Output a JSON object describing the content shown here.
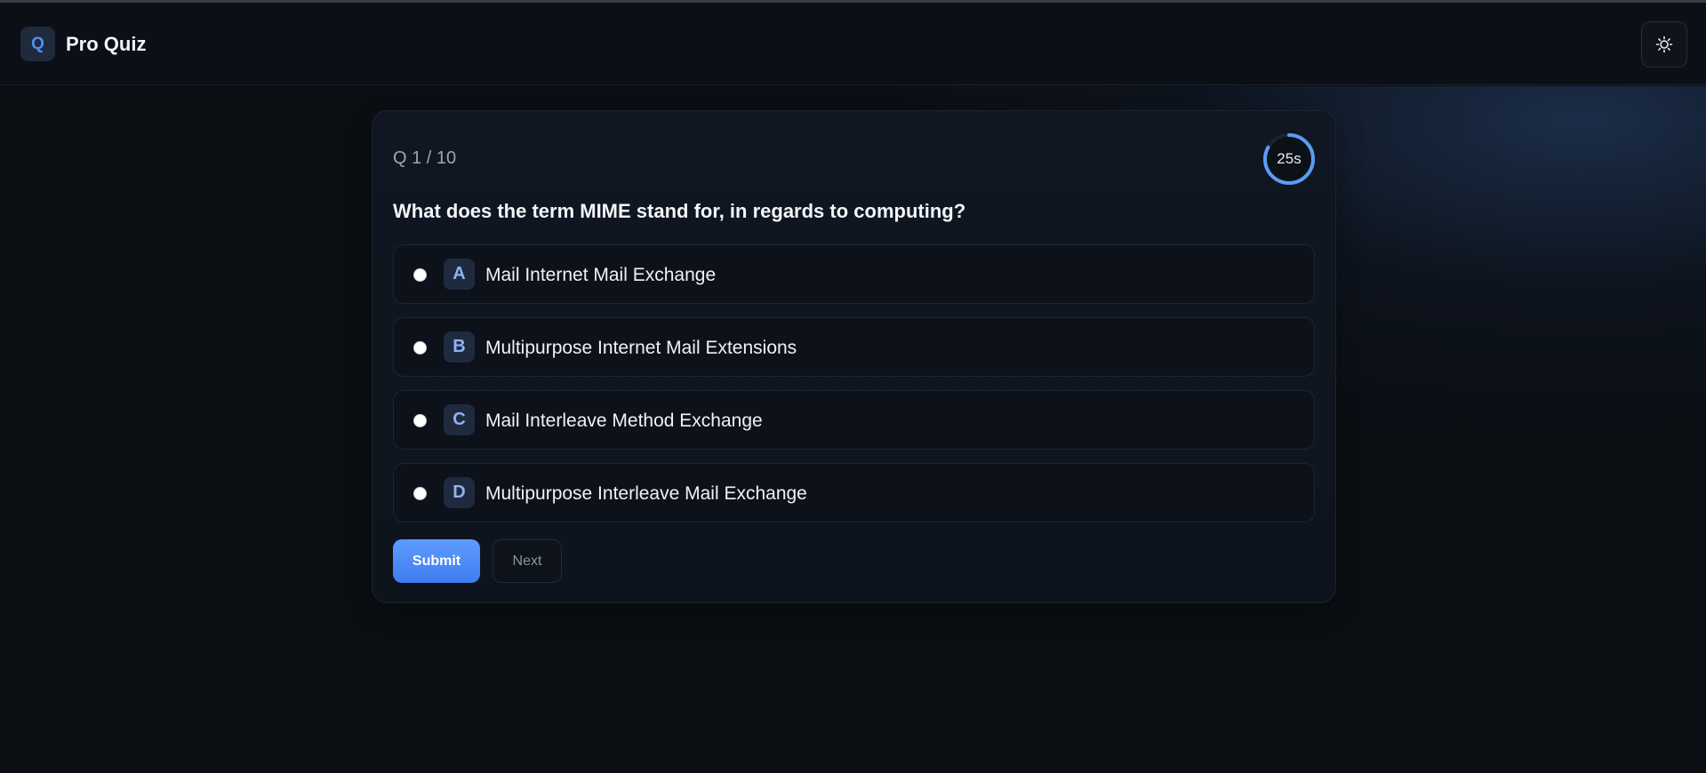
{
  "app": {
    "logo_letter": "Q",
    "title": "Pro Quiz"
  },
  "header": {
    "theme_toggle_icon": "sun-icon"
  },
  "quiz": {
    "counter": "Q 1 / 10",
    "timer_label": "25s",
    "timer_remaining_fraction": 0.83,
    "question": "What does the term MIME stand for, in regards to computing?",
    "options": [
      {
        "letter": "A",
        "text": "Mail Internet Mail Exchange",
        "selected": false
      },
      {
        "letter": "B",
        "text": "Multipurpose Internet Mail Extensions",
        "selected": false
      },
      {
        "letter": "C",
        "text": "Mail Interleave Method Exchange",
        "selected": false
      },
      {
        "letter": "D",
        "text": "Multipurpose Interleave Mail Exchange",
        "selected": false
      }
    ],
    "submit_label": "Submit",
    "next_label": "Next"
  },
  "colors": {
    "background": "#0b0e13",
    "accent": "#4f8ff7",
    "timer_ring": "#5b9cf5",
    "card": "#101722"
  }
}
